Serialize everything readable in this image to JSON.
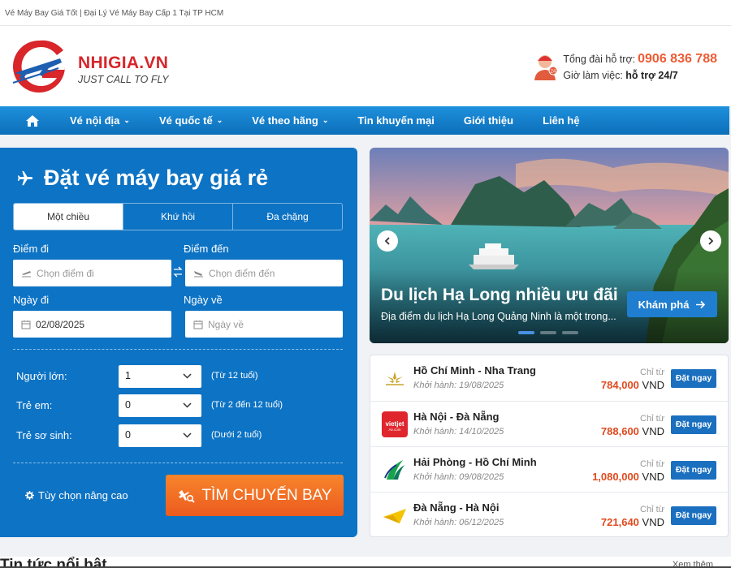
{
  "topbar": {
    "text": "Vé Máy Bay Giá Tốt | Đại Lý Vé Máy Bay Cấp 1 Tại TP HCM"
  },
  "header": {
    "brand_name": "NHIGIA.VN",
    "slogan": "JUST CALL TO FLY",
    "support_label": "Tổng đài hỗ trợ:",
    "hotline": "0906 836 788",
    "hours_label": "Giờ làm việc:",
    "hours_value": "hỗ trợ 24/7",
    "colors": {
      "brand_red": "#d8262a",
      "hotline_orange": "#ee5b33"
    }
  },
  "nav": {
    "items": [
      {
        "label": "Vé nội địa",
        "dropdown": true
      },
      {
        "label": "Vé quốc tế",
        "dropdown": true
      },
      {
        "label": "Vé theo hãng",
        "dropdown": true
      },
      {
        "label": "Tin khuyến mại",
        "dropdown": false
      },
      {
        "label": "Giới thiệu",
        "dropdown": false
      },
      {
        "label": "Liên hệ",
        "dropdown": false
      }
    ],
    "color": "#0d73c4"
  },
  "search_form": {
    "title": "Đặt vé máy bay giá rẻ",
    "tabs": [
      "Một chiều",
      "Khứ hồi",
      "Đa chặng"
    ],
    "active_tab": "Một chiều",
    "from_label": "Điểm đi",
    "from_placeholder": "Chọn điểm đi",
    "to_label": "Điểm đến",
    "to_placeholder": "Chọn điểm đến",
    "depart_label": "Ngày đi",
    "depart_value": "02/08/2025",
    "return_label": "Ngày về",
    "return_placeholder": "Ngày về",
    "passengers": [
      {
        "label": "Người lớn:",
        "value": "1",
        "note": "(Từ 12 tuổi)"
      },
      {
        "label": "Trẻ em:",
        "value": "0",
        "note": "(Từ 2 đến 12 tuổi)"
      },
      {
        "label": "Trẻ sơ sinh:",
        "value": "0",
        "note": "(Dưới 2 tuổi)"
      }
    ],
    "advanced_label": "Tùy chọn nâng cao",
    "search_button": "TÌM CHUYẾN BAY",
    "colors": {
      "panel": "#0d73c4",
      "button": "#ef6a23"
    }
  },
  "banner": {
    "title": "Du lịch Hạ Long nhiều ưu đãi",
    "description": "Địa điểm du lịch Hạ Long Quảng Ninh là một trong...",
    "button_label": "Khám phá",
    "slide_count": 3,
    "active_slide": 1
  },
  "flights": {
    "from_label": "Chỉ từ",
    "currency": "VND",
    "book_label": "Đặt ngay",
    "items": [
      {
        "route": "Hồ Chí Minh - Nha Trang",
        "date_text": "Khởi hành: 19/08/2025",
        "price": "784,000",
        "airline_icon": "bamboo-airways-icon"
      },
      {
        "route": "Hà Nội - Đà Nẵng",
        "date_text": "Khởi hành: 14/10/2025",
        "price": "788,600",
        "airline_icon": "vietjet-air-icon"
      },
      {
        "route": "Hải Phòng - Hồ Chí Minh",
        "date_text": "Khởi hành: 09/08/2025",
        "price": "1,080,000",
        "airline_icon": "vietravel-airlines-icon"
      },
      {
        "route": "Đà Nẵng - Hà Nội",
        "date_text": "Khởi hành: 06/12/2025",
        "price": "721,640",
        "airline_icon": "vietnam-airlines-icon"
      }
    ]
  },
  "footer_peek": {
    "title": "Tin tức nổi bật",
    "more_link": "Xem thêm"
  }
}
